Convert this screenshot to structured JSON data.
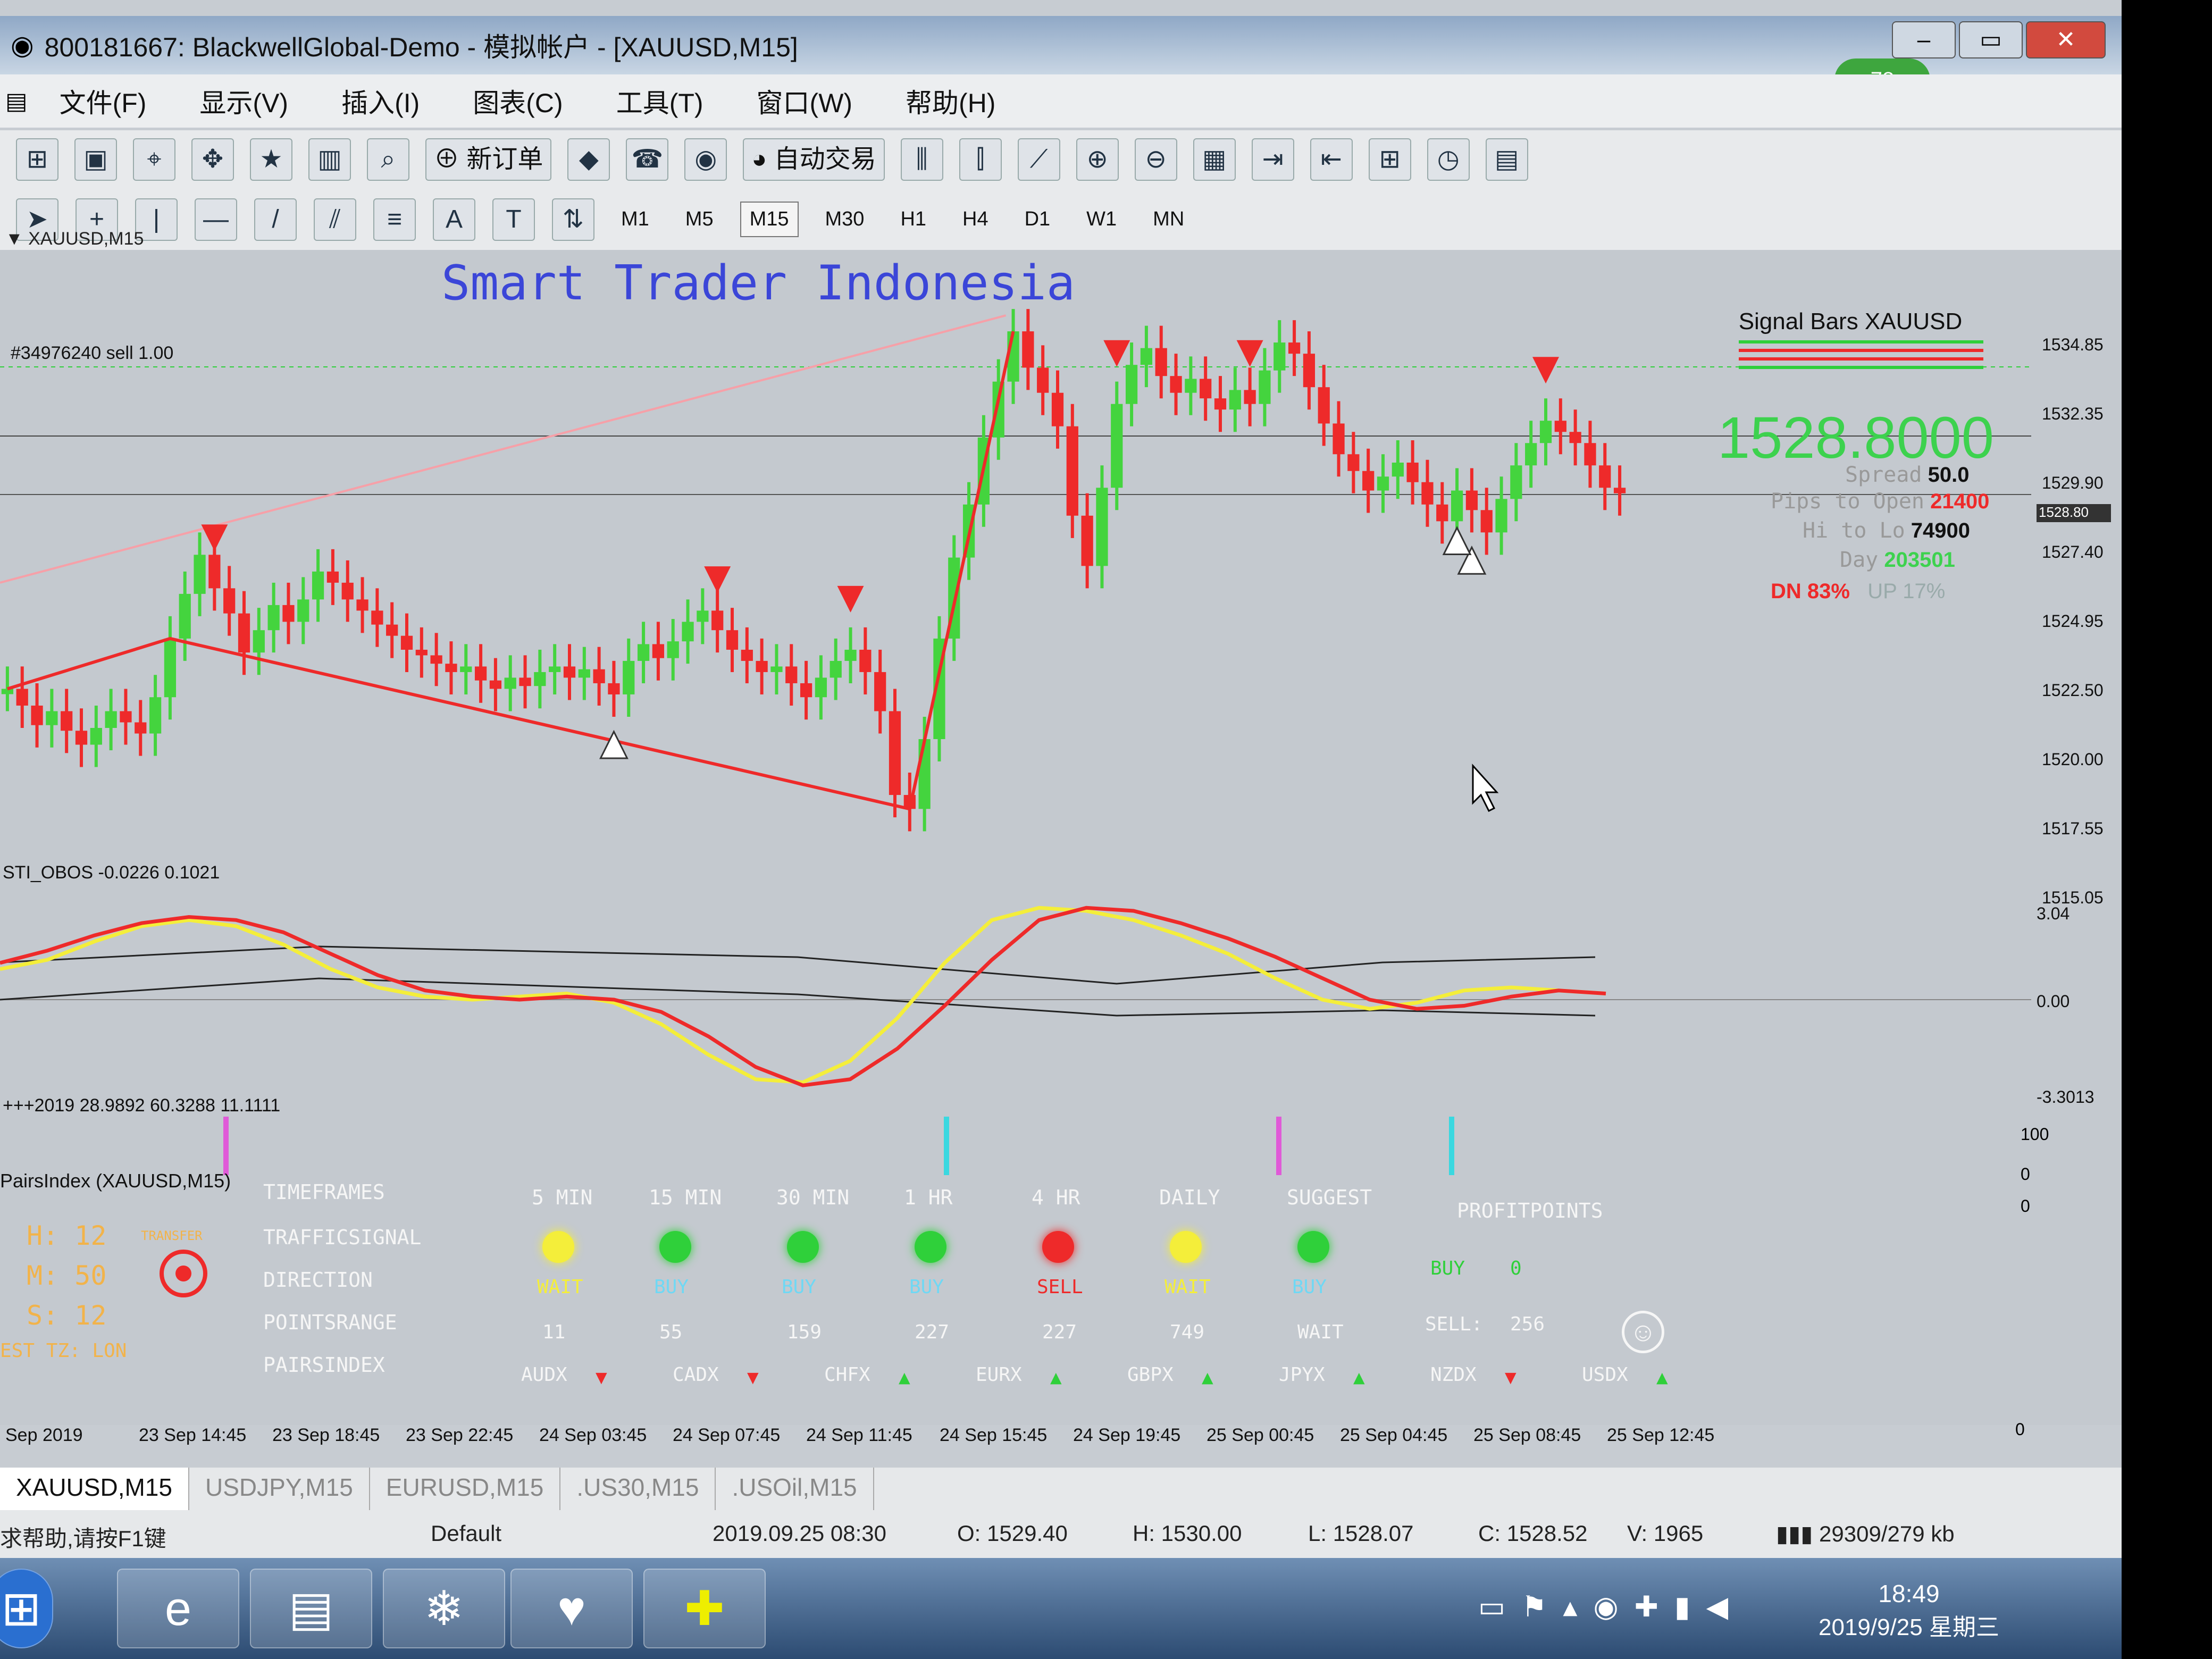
{
  "window": {
    "title": "800181667: BlackwellGlobal-Demo - 模拟帐户 - [XAUUSD,M15]",
    "badge": "78"
  },
  "menu": [
    "文件(F)",
    "显示(V)",
    "插入(I)",
    "图表(C)",
    "工具(T)",
    "窗口(W)",
    "帮助(H)"
  ],
  "toolbar": {
    "new_order": "新订单",
    "auto_trade": "自动交易"
  },
  "timeframes": [
    "M1",
    "M5",
    "M15",
    "M30",
    "H1",
    "H4",
    "D1",
    "W1",
    "MN"
  ],
  "selected_timeframe": "M15",
  "chart": {
    "symbol_header": "▼ XAUUSD,M15",
    "watermark": "Smart Trader Indonesia",
    "order_label": "#34976240 sell 1.00",
    "price_labels": [
      "1534.85",
      "1532.35",
      "1529.90",
      "1527.40",
      "1524.95",
      "1522.50",
      "1520.00",
      "1517.55",
      "1515.05"
    ],
    "highlight_price": "1528.80",
    "signal_bars": {
      "title": "Signal Bars XAUUSD",
      "price": "1528.8000",
      "spread_label": "Spread",
      "spread": "50.0",
      "pips_label": "Pips to Open",
      "pips": "21400",
      "hilo_label": "Hi to Lo",
      "hilo": "74900",
      "day_label": "Day",
      "day": "203501",
      "dn": "DN 83%",
      "up": "UP 17%"
    }
  },
  "chart_data": {
    "type": "line",
    "title": "",
    "y_range": [
      1515.05,
      1534.85
    ],
    "x_ticks": [
      "Sep 2019",
      "23 Sep 14:45",
      "23 Sep 18:45",
      "23 Sep 22:45",
      "24 Sep 03:45",
      "24 Sep 07:45",
      "24 Sep 11:45",
      "24 Sep 15:45",
      "24 Sep 19:45",
      "25 Sep 00:45",
      "25 Sep 04:45",
      "25 Sep 08:45",
      "25 Sep 12:45"
    ],
    "close": [
      1521.8,
      1521.2,
      1520.5,
      1521.0,
      1520.3,
      1519.8,
      1520.4,
      1521.0,
      1520.6,
      1520.2,
      1521.5,
      1523.6,
      1525.2,
      1526.6,
      1525.4,
      1524.5,
      1523.1,
      1523.9,
      1524.8,
      1524.2,
      1525.0,
      1526.0,
      1525.6,
      1525.0,
      1524.6,
      1524.1,
      1523.7,
      1523.2,
      1523.0,
      1522.7,
      1522.4,
      1522.6,
      1522.1,
      1521.8,
      1522.2,
      1521.9,
      1522.4,
      1522.6,
      1522.2,
      1522.5,
      1522.0,
      1521.6,
      1522.8,
      1523.4,
      1522.9,
      1523.5,
      1524.2,
      1524.6,
      1523.9,
      1523.2,
      1522.8,
      1522.4,
      1522.6,
      1522.0,
      1521.5,
      1522.2,
      1522.8,
      1523.2,
      1522.4,
      1521.0,
      1518.0,
      1517.5,
      1520.0,
      1523.6,
      1526.5,
      1528.4,
      1530.8,
      1532.8,
      1534.6,
      1533.3,
      1532.4,
      1531.2,
      1528.0,
      1526.2,
      1529.0,
      1532.0,
      1533.4,
      1534.0,
      1533.0,
      1532.4,
      1532.9,
      1532.2,
      1531.8,
      1532.5,
      1532.0,
      1533.2,
      1534.2,
      1533.8,
      1532.6,
      1531.3,
      1530.2,
      1529.6,
      1528.9,
      1529.4,
      1529.9,
      1529.2,
      1528.4,
      1527.8,
      1528.9,
      1528.2,
      1527.4,
      1528.6,
      1529.8,
      1530.6,
      1531.4,
      1531.0,
      1530.6,
      1529.8,
      1529.0,
      1528.8
    ],
    "series": [
      {
        "name": "STI_OBOS -0.0226",
        "obos_red": [
          1.2,
          1.6,
          2.1,
          2.5,
          2.7,
          2.6,
          2.2,
          1.5,
          0.8,
          0.3,
          0.1,
          0.0,
          0.1,
          0.0,
          -0.4,
          -1.2,
          -2.2,
          -2.8,
          -2.6,
          -1.6,
          -0.2,
          1.3,
          2.6,
          3.0,
          2.9,
          2.5,
          2.0,
          1.4,
          0.7,
          0.0,
          -0.3,
          -0.2,
          0.1,
          0.3,
          0.2
        ]
      },
      {
        "name": "0.1021",
        "obos_yellow": [
          1.0,
          1.3,
          1.9,
          2.4,
          2.6,
          2.4,
          1.8,
          1.0,
          0.4,
          0.1,
          0.0,
          0.1,
          0.2,
          -0.1,
          -0.8,
          -1.8,
          -2.6,
          -2.7,
          -2.0,
          -0.6,
          1.2,
          2.6,
          3.0,
          2.9,
          2.6,
          2.1,
          1.5,
          0.7,
          0.0,
          -0.3,
          -0.1,
          0.3,
          0.4,
          0.3,
          0.2
        ]
      }
    ],
    "obos_scale": [
      "3.04",
      "0.00",
      "-3.3013"
    ]
  },
  "obos": {
    "header": "STI_OBOS -0.0226 0.1021"
  },
  "hist": {
    "header": "+++2019 28.9892 60.3288 11.1111",
    "scale": [
      "100",
      "0"
    ]
  },
  "pairs": {
    "header": "PairsIndex (XAUUSD,M15)",
    "hms": {
      "h": "H: 12",
      "m": "M: 50",
      "s": "S: 12",
      "tz": "EST TZ: LON"
    },
    "sidebar_logo": "TRANSFER",
    "row_labels": [
      "TIMEFRAMES",
      "TRAFFICSIGNAL",
      "DIRECTION",
      "POINTSRANGE",
      "PAIRSINDEX"
    ],
    "columns": [
      {
        "tf": "5 MIN",
        "color": "#f4ee3a",
        "dir": "WAIT",
        "range": "11"
      },
      {
        "tf": "15 MIN",
        "color": "#2fd03a",
        "dir": "BUY",
        "range": "55"
      },
      {
        "tf": "30 MIN",
        "color": "#2fd03a",
        "dir": "BUY",
        "range": "159"
      },
      {
        "tf": "1 HR",
        "color": "#2fd03a",
        "dir": "BUY",
        "range": "227"
      },
      {
        "tf": "4 HR",
        "color": "#ee2a2a",
        "dir": "SELL",
        "range": "227"
      },
      {
        "tf": "DAILY",
        "color": "#f4ee3a",
        "dir": "WAIT",
        "range": "749"
      },
      {
        "tf": "SUGGEST",
        "color": "#2fd03a",
        "dir": "BUY",
        "range": "WAIT"
      }
    ],
    "profit_header": "PROFITPOINTS",
    "buy_label": "BUY",
    "buy_val": "0",
    "sell_label": "SELL:",
    "sell_val": "256",
    "pairs_index": [
      {
        "name": "AUDX",
        "arrow": "down"
      },
      {
        "name": "CADX",
        "arrow": "down"
      },
      {
        "name": "CHFX",
        "arrow": "up"
      },
      {
        "name": "EURX",
        "arrow": "up"
      },
      {
        "name": "GBPX",
        "arrow": "up"
      },
      {
        "name": "JPYX",
        "arrow": "up"
      },
      {
        "name": "NZDX",
        "arrow": "down"
      },
      {
        "name": "USDX",
        "arrow": "up"
      }
    ],
    "pairs_scale": [
      "0",
      "0"
    ]
  },
  "tabs": [
    "XAUUSD,M15",
    "USDJPY,M15",
    "EURUSD,M15",
    ".US30,M15",
    ".USOil,M15"
  ],
  "status": {
    "help": "求帮助,请按F1键",
    "profile": "Default",
    "datetime": "2019.09.25 08:30",
    "open": "O: 1529.40",
    "high": "H: 1530.00",
    "low": "L: 1528.07",
    "close": "C: 1528.52",
    "volume": "V: 1965",
    "traffic": "29309/279 kb"
  },
  "taskbar": {
    "time": "18:49",
    "date": "2019/9/25 星期三"
  }
}
